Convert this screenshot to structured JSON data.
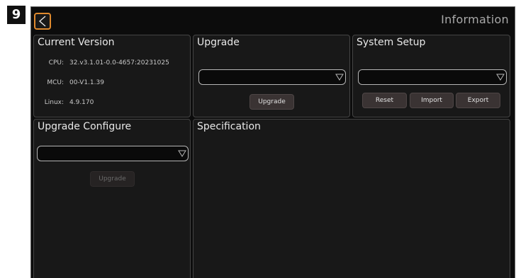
{
  "step_badge": "9",
  "header": {
    "title": "Information",
    "back_icon": "chevron-left-icon",
    "accent_color": "#e08a2e"
  },
  "current_version": {
    "title": "Current Version",
    "rows": [
      {
        "label": "CPU:",
        "value": "32.v3.1.01-0.0-4657:20231025"
      },
      {
        "label": "MCU:",
        "value": "00-V1.1.39"
      },
      {
        "label": "Linux:",
        "value": "4.9.170"
      }
    ]
  },
  "upgrade": {
    "title": "Upgrade",
    "select_value": "",
    "button_label": "Upgrade"
  },
  "system_setup": {
    "title": "System Setup",
    "select_value": "",
    "buttons": [
      "Reset",
      "Import",
      "Export"
    ]
  },
  "upgrade_configure": {
    "title": "Upgrade Configure",
    "select_value": "",
    "button_label": "Upgrade",
    "button_state": "disabled"
  },
  "specification": {
    "title": "Specification"
  }
}
